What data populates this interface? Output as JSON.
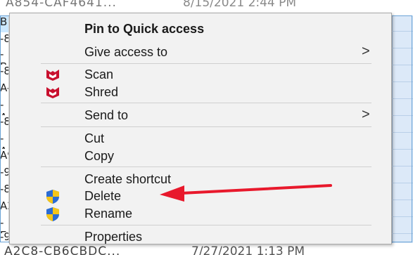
{
  "background": {
    "top_row_name": "A854-CAF4641...",
    "top_row_date": "8/15/2021 2:44 PM",
    "bottom_row_name": "A2C8-CB6CBDC...",
    "bottom_row_date": "7/27/2021 1:13 PM",
    "left_fragments": [
      "B",
      "-8",
      "-B",
      "-8",
      "A-",
      "-A",
      "-8",
      "-A",
      "A9",
      "-9",
      "-8",
      "A2",
      "-E",
      "-9"
    ]
  },
  "menu": {
    "items": [
      {
        "id": "pin",
        "label": "Pin to Quick access",
        "bold": true,
        "submenu": false,
        "icon": ""
      },
      {
        "id": "give-access",
        "label": "Give access to",
        "bold": false,
        "submenu": true,
        "icon": ""
      },
      {
        "id": "scan",
        "label": "Scan",
        "bold": false,
        "submenu": false,
        "icon": "mcafee-icon"
      },
      {
        "id": "shred",
        "label": "Shred",
        "bold": false,
        "submenu": false,
        "icon": "mcafee-icon"
      },
      {
        "id": "send-to",
        "label": "Send to",
        "bold": false,
        "submenu": true,
        "icon": ""
      },
      {
        "id": "cut",
        "label": "Cut",
        "bold": false,
        "submenu": false,
        "icon": ""
      },
      {
        "id": "copy",
        "label": "Copy",
        "bold": false,
        "submenu": false,
        "icon": ""
      },
      {
        "id": "create-shortcut",
        "label": "Create shortcut",
        "bold": false,
        "submenu": false,
        "icon": ""
      },
      {
        "id": "delete",
        "label": "Delete",
        "bold": false,
        "submenu": false,
        "icon": "uac-shield-icon"
      },
      {
        "id": "rename",
        "label": "Rename",
        "bold": false,
        "submenu": false,
        "icon": "uac-shield-icon"
      },
      {
        "id": "properties",
        "label": "Properties",
        "bold": false,
        "submenu": false,
        "icon": ""
      }
    ],
    "submenu_glyph": ">"
  },
  "colors": {
    "mcafee_red": "#c8102e",
    "annotation_arrow": "#e8192c",
    "shield_blue": "#2b6cd4",
    "shield_yellow": "#f5c518"
  }
}
